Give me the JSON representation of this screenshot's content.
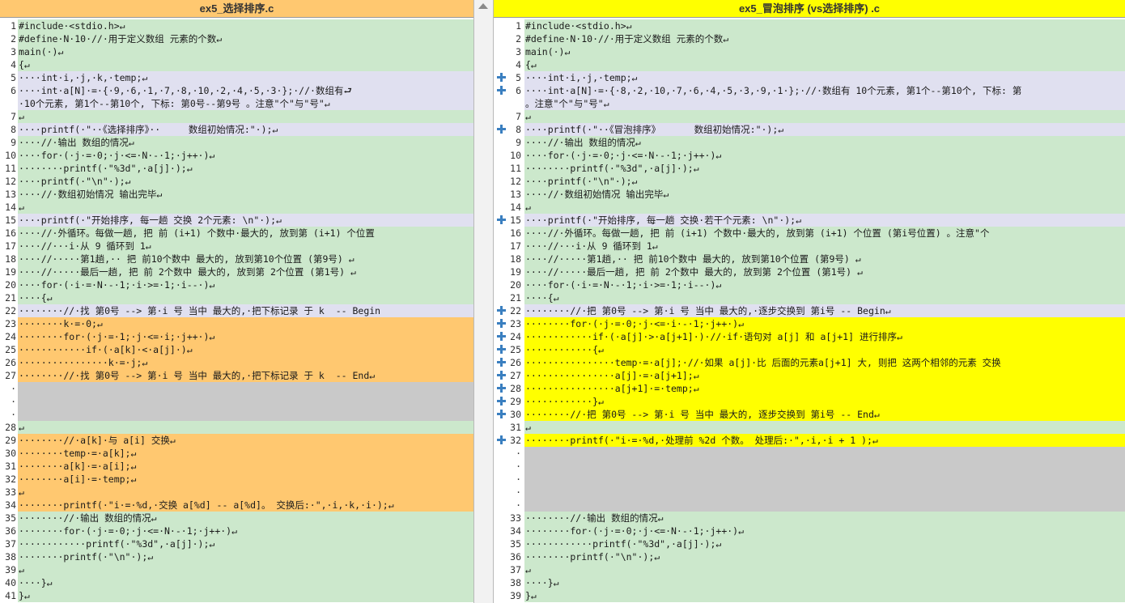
{
  "left": {
    "title": "ex5_选择排序.c",
    "lines": [
      {
        "n": "1",
        "t": "#include·<stdio.h>↵",
        "s": "same"
      },
      {
        "n": "2",
        "t": "#define·N·10·//·用于定义数组 元素的个数↵",
        "s": "same"
      },
      {
        "n": "3",
        "t": "main(·)↵",
        "s": "same"
      },
      {
        "n": "4",
        "t": "{↵",
        "s": "same"
      },
      {
        "n": "5",
        "t": "····int·i,·j,·k,·temp;↵",
        "s": "mod"
      },
      {
        "n": "6",
        "t": "····int·a[N]·=·{·9,·6,·1,·7,·8,·10,·2,·4,·5,·3·};·//·数组有⮐",
        "s": "mod"
      },
      {
        "n": "",
        "t": "·10个元素, 第1个--第10个, 下标: 第0号--第9号 。注意\"个\"与\"号\"↵",
        "s": "mod"
      },
      {
        "n": "7",
        "t": "↵",
        "s": "same"
      },
      {
        "n": "8",
        "t": "····printf(·\"··《选择排序》··     数组初始情况:\"·);↵",
        "s": "mod"
      },
      {
        "n": "9",
        "t": "····//·输出 数组的情况↵",
        "s": "same"
      },
      {
        "n": "10",
        "t": "····for·(·j·=·0;·j·<=·N·-·1;·j++·)↵",
        "s": "same"
      },
      {
        "n": "11",
        "t": "········printf(·\"%3d\",·a[j]·);↵",
        "s": "same"
      },
      {
        "n": "12",
        "t": "····printf(·\"\\n\"·);↵",
        "s": "same"
      },
      {
        "n": "13",
        "t": "····//·数组初始情况 输出完毕↵",
        "s": "same"
      },
      {
        "n": "14",
        "t": "↵",
        "s": "same"
      },
      {
        "n": "15",
        "t": "····printf(·\"开始排序, 每一趟 交换 2个元素: \\n\"·);↵",
        "s": "mod"
      },
      {
        "n": "16",
        "t": "····//·外循环。每做一趟, 把 前 (i+1) 个数中·最大的, 放到第 (i+1) 个位置",
        "s": "same"
      },
      {
        "n": "17",
        "t": "····//···i·从 9 循环到 1↵",
        "s": "same"
      },
      {
        "n": "18",
        "t": "····//·····第1趟,·· 把 前10个数中 最大的, 放到第10个位置 (第9号) ↵",
        "s": "same"
      },
      {
        "n": "19",
        "t": "····//·····最后一趟, 把 前 2个数中 最大的, 放到第 2个位置 (第1号) ↵",
        "s": "same"
      },
      {
        "n": "20",
        "t": "····for·(·i·=·N·-·1;·i·>=·1;·i--·)↵",
        "s": "same"
      },
      {
        "n": "21",
        "t": "····{↵",
        "s": "same"
      },
      {
        "n": "22",
        "t": "········//·找 第0号 --> 第·i 号 当中 最大的,·把下标记录 于 k  -- Begin",
        "s": "mod"
      },
      {
        "n": "23",
        "t": "········k·=·0;↵",
        "s": "ldiff"
      },
      {
        "n": "24",
        "t": "········for·(·j·=·1;·j·<=·i;·j++·)↵",
        "s": "ldiff"
      },
      {
        "n": "25",
        "t": "············if·(·a[k]·<·a[j]·)↵",
        "s": "ldiff"
      },
      {
        "n": "26",
        "t": "················k·=·j;↵",
        "s": "ldiff"
      },
      {
        "n": "27",
        "t": "········//·找 第0号 --> 第·i 号 当中 最大的,·把下标记录 于 k  -- End↵",
        "s": "ldiff"
      },
      {
        "n": "·",
        "t": "",
        "s": "filler"
      },
      {
        "n": "·",
        "t": "",
        "s": "filler"
      },
      {
        "n": "·",
        "t": "",
        "s": "filler"
      },
      {
        "n": "28",
        "t": "↵",
        "s": "same"
      },
      {
        "n": "29",
        "t": "········//·a[k]·与 a[i] 交换↵",
        "s": "ldiff"
      },
      {
        "n": "30",
        "t": "········temp·=·a[k];↵",
        "s": "ldiff"
      },
      {
        "n": "31",
        "t": "········a[k]·=·a[i];↵",
        "s": "ldiff"
      },
      {
        "n": "32",
        "t": "········a[i]·=·temp;↵",
        "s": "ldiff"
      },
      {
        "n": "33",
        "t": "↵",
        "s": "ldiff"
      },
      {
        "n": "34",
        "t": "········printf(·\"i·=·%d,·交换 a[%d] -- a[%d]。 交换后:·\",·i,·k,·i·);↵",
        "s": "ldiff"
      },
      {
        "n": "35",
        "t": "········//·输出 数组的情况↵",
        "s": "same"
      },
      {
        "n": "36",
        "t": "········for·(·j·=·0;·j·<=·N·-·1;·j++·)↵",
        "s": "same"
      },
      {
        "n": "37",
        "t": "············printf(·\"%3d\",·a[j]·);↵",
        "s": "same"
      },
      {
        "n": "38",
        "t": "········printf(·\"\\n\"·);↵",
        "s": "same"
      },
      {
        "n": "39",
        "t": "↵",
        "s": "same"
      },
      {
        "n": "40",
        "t": "····}↵",
        "s": "same"
      },
      {
        "n": "41",
        "t": "}↵",
        "s": "same"
      }
    ]
  },
  "right": {
    "title": "ex5_冒泡排序 (vs选择排序) .c",
    "lines": [
      {
        "n": "1",
        "t": "#include·<stdio.h>↵",
        "s": "same",
        "p": false
      },
      {
        "n": "2",
        "t": "#define·N·10·//·用于定义数组 元素的个数↵",
        "s": "same",
        "p": false
      },
      {
        "n": "3",
        "t": "main(·)↵",
        "s": "same",
        "p": false
      },
      {
        "n": "4",
        "t": "{↵",
        "s": "same",
        "p": false
      },
      {
        "n": "5",
        "t": "····int·i,·j,·temp;↵",
        "s": "mod",
        "p": true
      },
      {
        "n": "6",
        "t": "····int·a[N]·=·{·8,·2,·10,·7,·6,·4,·5,·3,·9,·1·};·//·数组有 10个元素, 第1个--第10个, 下标: 第",
        "s": "mod",
        "p": true
      },
      {
        "n": "",
        "t": "。注意\"个\"与\"号\"↵",
        "s": "mod",
        "p": false
      },
      {
        "n": "7",
        "t": "↵",
        "s": "same",
        "p": false
      },
      {
        "n": "8",
        "t": "····printf(·\"··《冒泡排序》      数组初始情况:\"·);↵",
        "s": "mod",
        "p": true
      },
      {
        "n": "9",
        "t": "····//·输出 数组的情况↵",
        "s": "same",
        "p": false
      },
      {
        "n": "10",
        "t": "····for·(·j·=·0;·j·<=·N·-·1;·j++·)↵",
        "s": "same",
        "p": false
      },
      {
        "n": "11",
        "t": "········printf(·\"%3d\",·a[j]·);↵",
        "s": "same",
        "p": false
      },
      {
        "n": "12",
        "t": "····printf(·\"\\n\"·);↵",
        "s": "same",
        "p": false
      },
      {
        "n": "13",
        "t": "····//·数组初始情况 输出完毕↵",
        "s": "same",
        "p": false
      },
      {
        "n": "14",
        "t": "↵",
        "s": "same",
        "p": false
      },
      {
        "n": "15",
        "t": "····printf(·\"开始排序, 每一趟 交换·若干个元素: \\n\"·);↵",
        "s": "mod",
        "p": true
      },
      {
        "n": "16",
        "t": "····//·外循环。每做一趟, 把 前 (i+1) 个数中·最大的, 放到第 (i+1) 个位置 (第i号位置) 。注意\"个",
        "s": "same",
        "p": false
      },
      {
        "n": "17",
        "t": "····//···i·从 9 循环到 1↵",
        "s": "same",
        "p": false
      },
      {
        "n": "18",
        "t": "····//·····第1趟,·· 把 前10个数中 最大的, 放到第10个位置 (第9号) ↵",
        "s": "same",
        "p": false
      },
      {
        "n": "19",
        "t": "····//·····最后一趟, 把 前 2个数中 最大的, 放到第 2个位置 (第1号) ↵",
        "s": "same",
        "p": false
      },
      {
        "n": "20",
        "t": "····for·(·i·=·N·-·1;·i·>=·1;·i--·)↵",
        "s": "same",
        "p": false
      },
      {
        "n": "21",
        "t": "····{↵",
        "s": "same",
        "p": false
      },
      {
        "n": "22",
        "t": "········//·把 第0号 --> 第·i 号 当中 最大的,·逐步交换到 第i号 -- Begin↵",
        "s": "mod",
        "p": true
      },
      {
        "n": "23",
        "t": "········for·(·j·=·0;·j·<=·i·-·1;·j++·)↵",
        "s": "ydiff",
        "p": true
      },
      {
        "n": "24",
        "t": "············if·(·a[j]·>·a[j+1]·)·//·if·语句对 a[j] 和 a[j+1] 进行排序↵",
        "s": "ydiff",
        "p": true
      },
      {
        "n": "25",
        "t": "············{↵",
        "s": "ydiff",
        "p": true
      },
      {
        "n": "26",
        "t": "················temp·=·a[j];·//·如果 a[j]·比 后面的元素a[j+1] 大, 则把 这两个相邻的元素 交换",
        "s": "ydiff",
        "p": true
      },
      {
        "n": "27",
        "t": "················a[j]·=·a[j+1];↵",
        "s": "ydiff",
        "p": true
      },
      {
        "n": "28",
        "t": "················a[j+1]·=·temp;↵",
        "s": "ydiff",
        "p": true
      },
      {
        "n": "29",
        "t": "············}↵",
        "s": "ydiff",
        "p": true
      },
      {
        "n": "30",
        "t": "········//·把 第0号 --> 第·i 号 当中 最大的, 逐步交换到 第i号 -- End↵",
        "s": "ydiff",
        "p": true
      },
      {
        "n": "31",
        "t": "↵",
        "s": "same",
        "p": false
      },
      {
        "n": "32",
        "t": "········printf(·\"i·=·%d,·处理前 %2d 个数。 处理后:·\",·i,·i + 1 );↵",
        "s": "ydiff",
        "p": true
      },
      {
        "n": "·",
        "t": "",
        "s": "filler",
        "p": false
      },
      {
        "n": "·",
        "t": "",
        "s": "filler",
        "p": false
      },
      {
        "n": "·",
        "t": "",
        "s": "filler",
        "p": false
      },
      {
        "n": "·",
        "t": "",
        "s": "filler",
        "p": false
      },
      {
        "n": "·",
        "t": "",
        "s": "filler",
        "p": false
      },
      {
        "n": "33",
        "t": "········//·输出 数组的情况↵",
        "s": "same",
        "p": false
      },
      {
        "n": "34",
        "t": "········for·(·j·=·0;·j·<=·N·-·1;·j++·)↵",
        "s": "same",
        "p": false
      },
      {
        "n": "35",
        "t": "············printf(·\"%3d\",·a[j]·);↵",
        "s": "same",
        "p": false
      },
      {
        "n": "36",
        "t": "········printf(·\"\\n\"·);↵",
        "s": "same",
        "p": false
      },
      {
        "n": "37",
        "t": "↵",
        "s": "same",
        "p": false
      },
      {
        "n": "38",
        "t": "····}↵",
        "s": "same",
        "p": false
      },
      {
        "n": "39",
        "t": "}↵",
        "s": "same",
        "p": false
      }
    ]
  },
  "colors": {
    "same": "#cce8cc",
    "left_diff": "#ffc870",
    "right_diff": "#ffff00",
    "modified": "#e0e0f0",
    "filler": "#c9c9c9",
    "word_highlight": "#c86a5a",
    "plus_icon": "#3a7fc0"
  }
}
